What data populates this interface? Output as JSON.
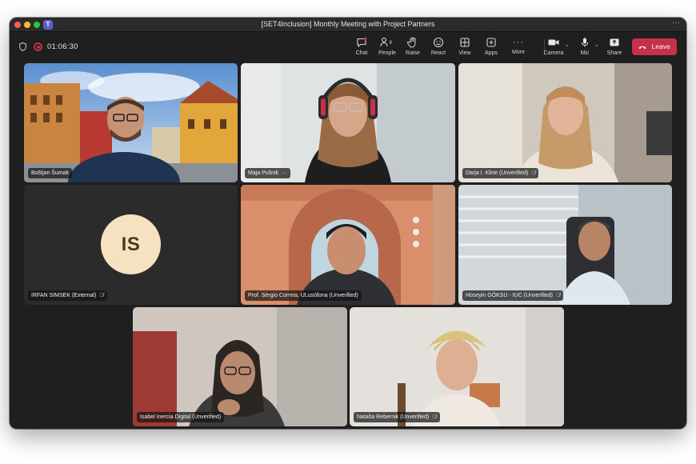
{
  "window": {
    "title": "[SET4Inclusion] Monthly Meeting with Project Partners",
    "more_glyph": "···"
  },
  "toolbar": {
    "timer": "01:06:30",
    "buttons": [
      {
        "id": "chat",
        "label": "Chat",
        "icon": "chat-icon"
      },
      {
        "id": "people",
        "label": "People",
        "icon": "people-icon",
        "count": "8"
      },
      {
        "id": "raise",
        "label": "Raise",
        "icon": "hand-icon"
      },
      {
        "id": "react",
        "label": "React",
        "icon": "smiley-icon"
      },
      {
        "id": "view",
        "label": "View",
        "icon": "grid-icon"
      },
      {
        "id": "apps",
        "label": "Apps",
        "icon": "plus-square-icon"
      },
      {
        "id": "more",
        "label": "More",
        "icon": "ellipsis-icon"
      },
      {
        "id": "camera",
        "label": "Camera",
        "icon": "camera-icon"
      },
      {
        "id": "mic",
        "label": "Mic",
        "icon": "mic-icon"
      },
      {
        "id": "share",
        "label": "Share",
        "icon": "share-icon"
      }
    ],
    "leave_label": "Leave"
  },
  "participants": [
    {
      "name": "Boštjan Šumak",
      "muted": false,
      "speaking": false,
      "video": true
    },
    {
      "name": "Maja Pušnik",
      "muted": false,
      "speaking": true,
      "video": true,
      "more_glyph": "···"
    },
    {
      "name": "Darja I. Kline (Unverified)",
      "muted": true,
      "speaking": false,
      "video": true
    },
    {
      "name": "IRFAN SIMSEK (External)",
      "muted": true,
      "speaking": false,
      "video": false,
      "initials": "IS"
    },
    {
      "name": "Prof. Sérgio Correia, ULusófona (Unverified)",
      "muted": false,
      "speaking": false,
      "video": true
    },
    {
      "name": "Hüseyin GÖKSU - IUC (Unverified)",
      "muted": true,
      "speaking": false,
      "video": true
    },
    {
      "name": "Isabel Inercia Digital (Unverified)",
      "muted": false,
      "speaking": false,
      "video": true
    },
    {
      "name": "Nataša Rebernik (Unverified)",
      "muted": true,
      "speaking": false,
      "video": true
    }
  ],
  "colors": {
    "accent": "#7f85f5",
    "leave": "#c4314b",
    "avatar_bg": "#f6e2c0"
  }
}
